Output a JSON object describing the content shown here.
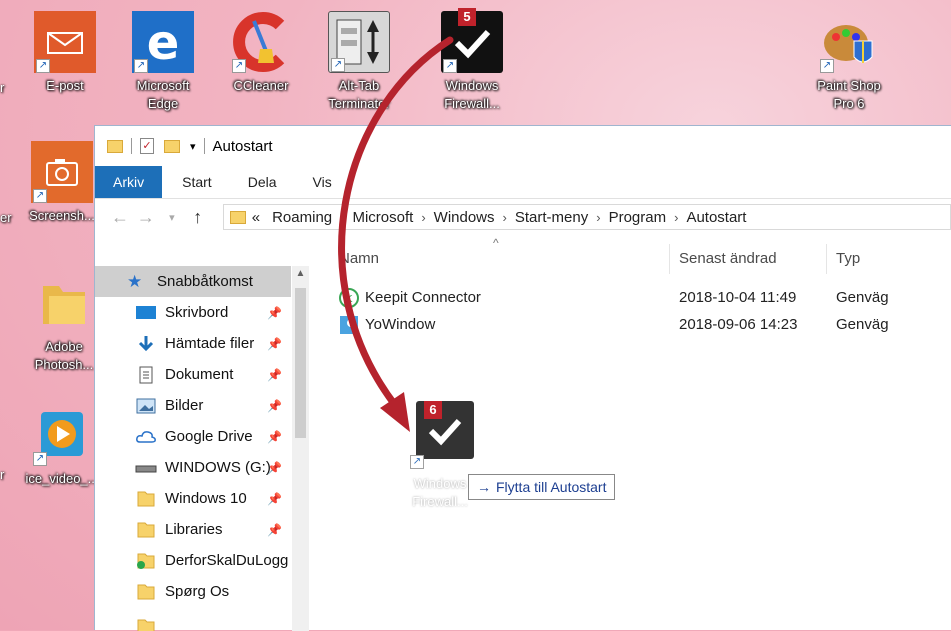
{
  "desktop": {
    "icons": [
      {
        "label": "E-post",
        "icon": "mail-icon"
      },
      {
        "label": "Microsoft Edge",
        "icon": "edge-icon"
      },
      {
        "label": "CCleaner",
        "icon": "ccleaner-icon"
      },
      {
        "label": "Alt-Tab Terminator",
        "icon": "alttab-icon"
      },
      {
        "label": "Windows Firewall...",
        "icon": "checkmark-icon"
      },
      {
        "label": "Paint Shop Pro 6",
        "icon": "paintshop-icon"
      },
      {
        "label": "Screensh...",
        "icon": "camera-icon"
      },
      {
        "label": "Adobe Photosh...",
        "icon": "folder-icon"
      },
      {
        "label": "ice_video_...",
        "icon": "video-icon"
      }
    ],
    "edge_labels": [
      "r",
      "er",
      "r"
    ]
  },
  "annotations": {
    "badge_top": "5",
    "badge_drag": "6"
  },
  "explorer": {
    "title": "Autostart",
    "ribbon_tabs": [
      "Arkiv",
      "Start",
      "Dela",
      "Vis"
    ],
    "address": {
      "prefix": "«",
      "crumbs": [
        "Roaming",
        "Microsoft",
        "Windows",
        "Start-meny",
        "Program",
        "Autostart"
      ]
    },
    "nav": {
      "quick_access": "Snabbåtkomst",
      "items": [
        {
          "label": "Skrivbord",
          "icon": "desktop-icon",
          "pinned": true
        },
        {
          "label": "Hämtade filer",
          "icon": "download-icon",
          "pinned": true
        },
        {
          "label": "Dokument",
          "icon": "document-icon",
          "pinned": true
        },
        {
          "label": "Bilder",
          "icon": "pictures-icon",
          "pinned": true
        },
        {
          "label": "Google Drive",
          "icon": "cloud-icon",
          "pinned": true
        },
        {
          "label": "WINDOWS (G:)",
          "icon": "drive-icon",
          "pinned": true
        },
        {
          "label": "Windows 10",
          "icon": "folder-icon",
          "pinned": true
        },
        {
          "label": "Libraries",
          "icon": "folder-icon",
          "pinned": true
        },
        {
          "label": "DerforSkalDuLogg",
          "icon": "folder-sync-icon",
          "pinned": false
        },
        {
          "label": "Spørg Os",
          "icon": "folder-icon",
          "pinned": false
        }
      ]
    },
    "columns": {
      "name": "Namn",
      "date": "Senast ändrad",
      "type": "Typ"
    },
    "files": [
      {
        "name": "Keepit Connector",
        "date": "2018-10-04 11:49",
        "type": "Genväg",
        "icon": "keepit-icon"
      },
      {
        "name": "YoWindow",
        "date": "2018-09-06 14:23",
        "type": "Genväg",
        "icon": "yowindow-icon"
      }
    ]
  },
  "drag": {
    "label": "Windows Firewall...",
    "tooltip_arrow": "→",
    "tooltip": "Flytta till Autostart"
  },
  "colors": {
    "accent": "#1d6fb8",
    "badge": "#c0222b",
    "arrow": "#b5232d"
  }
}
